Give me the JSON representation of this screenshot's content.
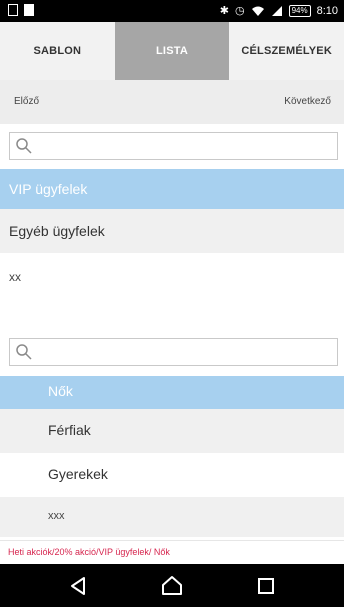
{
  "status_bar": {
    "battery": "94%",
    "time": "8:10",
    "icons": [
      "message-icon",
      "sim-icon",
      "bluetooth-icon",
      "alarm-icon",
      "wifi-icon",
      "signal-icon",
      "battery-icon"
    ]
  },
  "tabs": [
    {
      "label": "SABLON",
      "active": false
    },
    {
      "label": "LISTA",
      "active": true
    },
    {
      "label": "CÉLSZEMÉLYEK",
      "active": false
    }
  ],
  "pager": {
    "prev_label": "Előző",
    "next_label": "Következő"
  },
  "list1": {
    "items": [
      {
        "label": "VIP ügyfelek",
        "selected": true
      },
      {
        "label": "Egyéb ügyfelek",
        "selected": false
      },
      {
        "label": "xx",
        "selected": false
      }
    ]
  },
  "list2": {
    "items": [
      {
        "label": "Nők",
        "selected": true
      },
      {
        "label": "Férfiak",
        "selected": false
      },
      {
        "label": "Gyerekek",
        "selected": false
      },
      {
        "label": "xxx",
        "selected": false
      }
    ]
  },
  "footer": {
    "path": "Heti akciók/20% akció/VIP ügyfelek/ Nők"
  },
  "nav_buttons": [
    "back-icon",
    "home-icon",
    "recents-icon"
  ],
  "colors": {
    "selected_bg": "#a7d0ef",
    "active_tab_bg": "#a6a6a6",
    "path_text": "#d6264f"
  }
}
